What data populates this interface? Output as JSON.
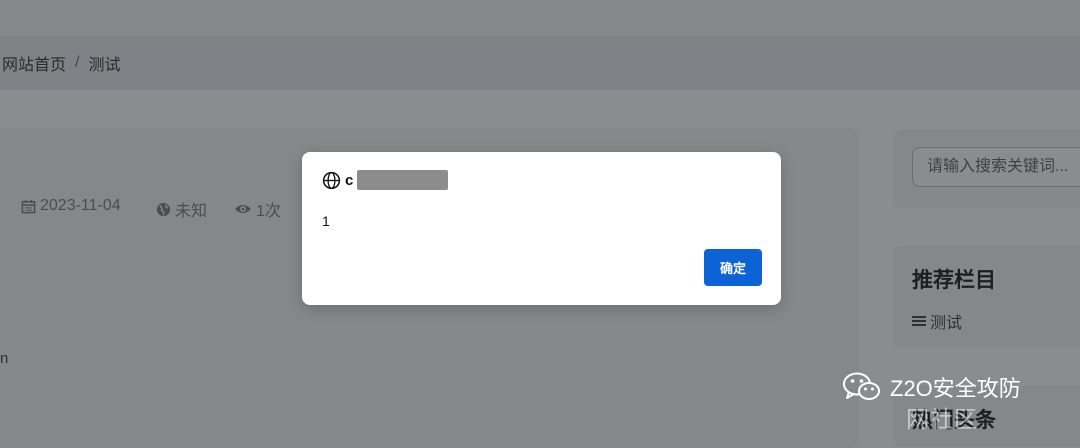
{
  "breadcrumb": {
    "home": "网站首页",
    "separator": "/",
    "current": "测试"
  },
  "article": {
    "date": "2023-11-04",
    "location": "未知",
    "views": "1次",
    "text_fragment": "n"
  },
  "sidebar": {
    "search_placeholder": "请输入搜索关键词...",
    "recommend_title": "推荐栏目",
    "recommend_items": [
      "测试"
    ],
    "hot_title": "热门头条"
  },
  "dialog": {
    "origin_prefix": "c",
    "message": "1",
    "ok_label": "确定"
  },
  "watermark": {
    "brand": "Z2O安全攻防",
    "sub": "网社区"
  },
  "colors": {
    "accent": "#0b63d6",
    "overlay": "#8a8c8f"
  }
}
